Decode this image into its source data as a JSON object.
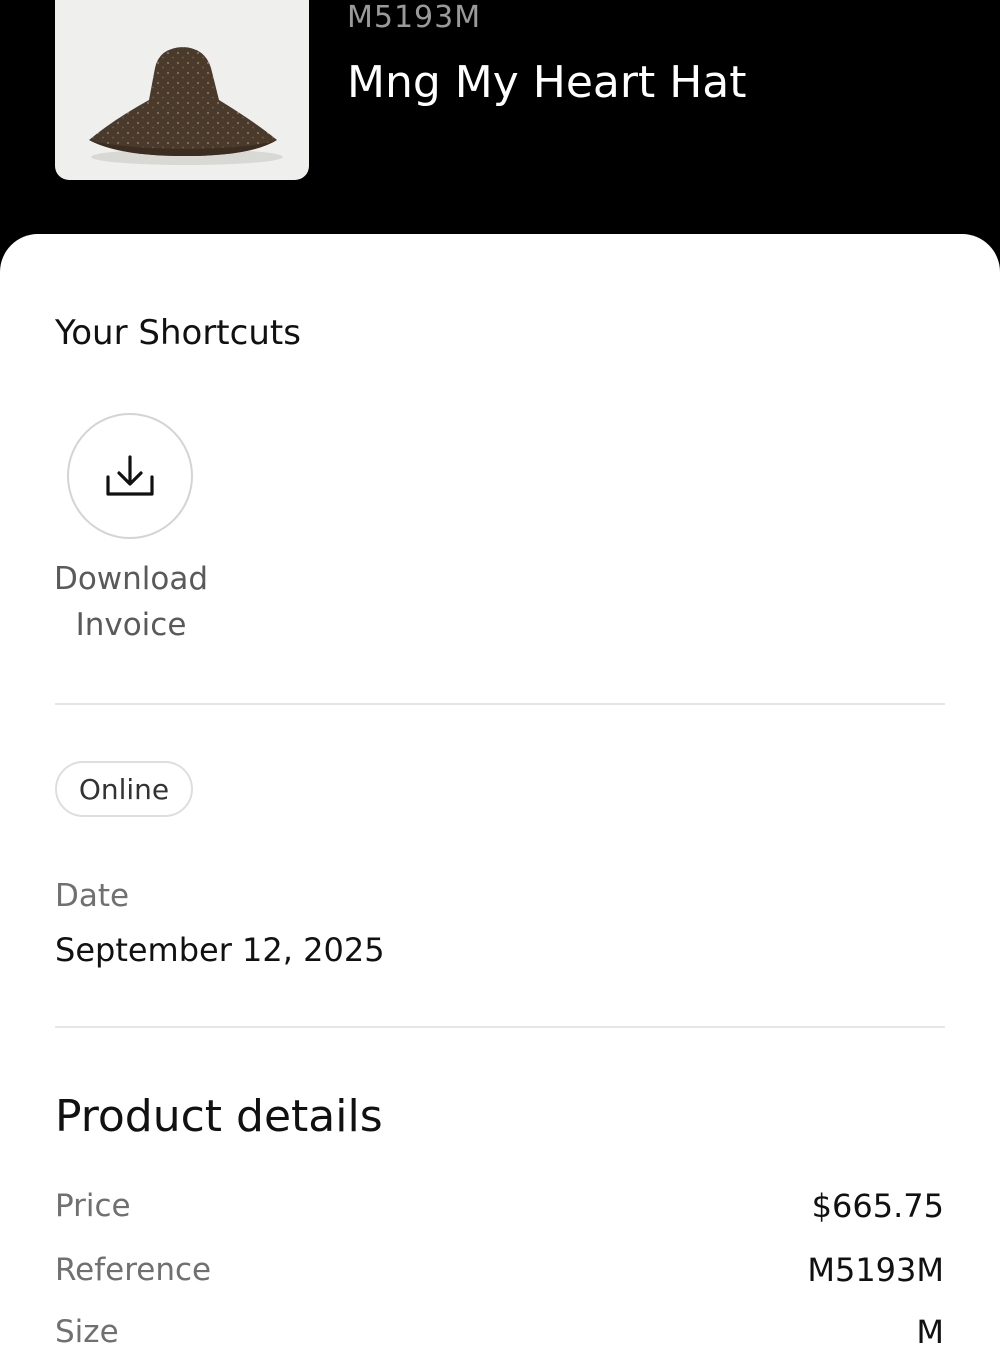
{
  "header": {
    "reference_code": "M5193M",
    "product_name": "Mng My Heart Hat",
    "thumbnail_icon": "bucket-hat-image"
  },
  "shortcuts": {
    "title": "Your Shortcuts",
    "items": [
      {
        "label_line1": "Download",
        "label_line2": "Invoice",
        "icon": "download-icon"
      }
    ]
  },
  "order": {
    "channel_badge": "Online",
    "date_label": "Date",
    "date_value": "September 12, 2025"
  },
  "product_details": {
    "title": "Product details",
    "rows": [
      {
        "label": "Price",
        "value": "$665.75"
      },
      {
        "label": "Reference",
        "value": "M5193M"
      },
      {
        "label": "Size",
        "value": "M"
      }
    ]
  },
  "colors": {
    "header_bg": "#000000",
    "sheet_bg": "#ffffff",
    "hat_brown": "#4a3a2c"
  }
}
